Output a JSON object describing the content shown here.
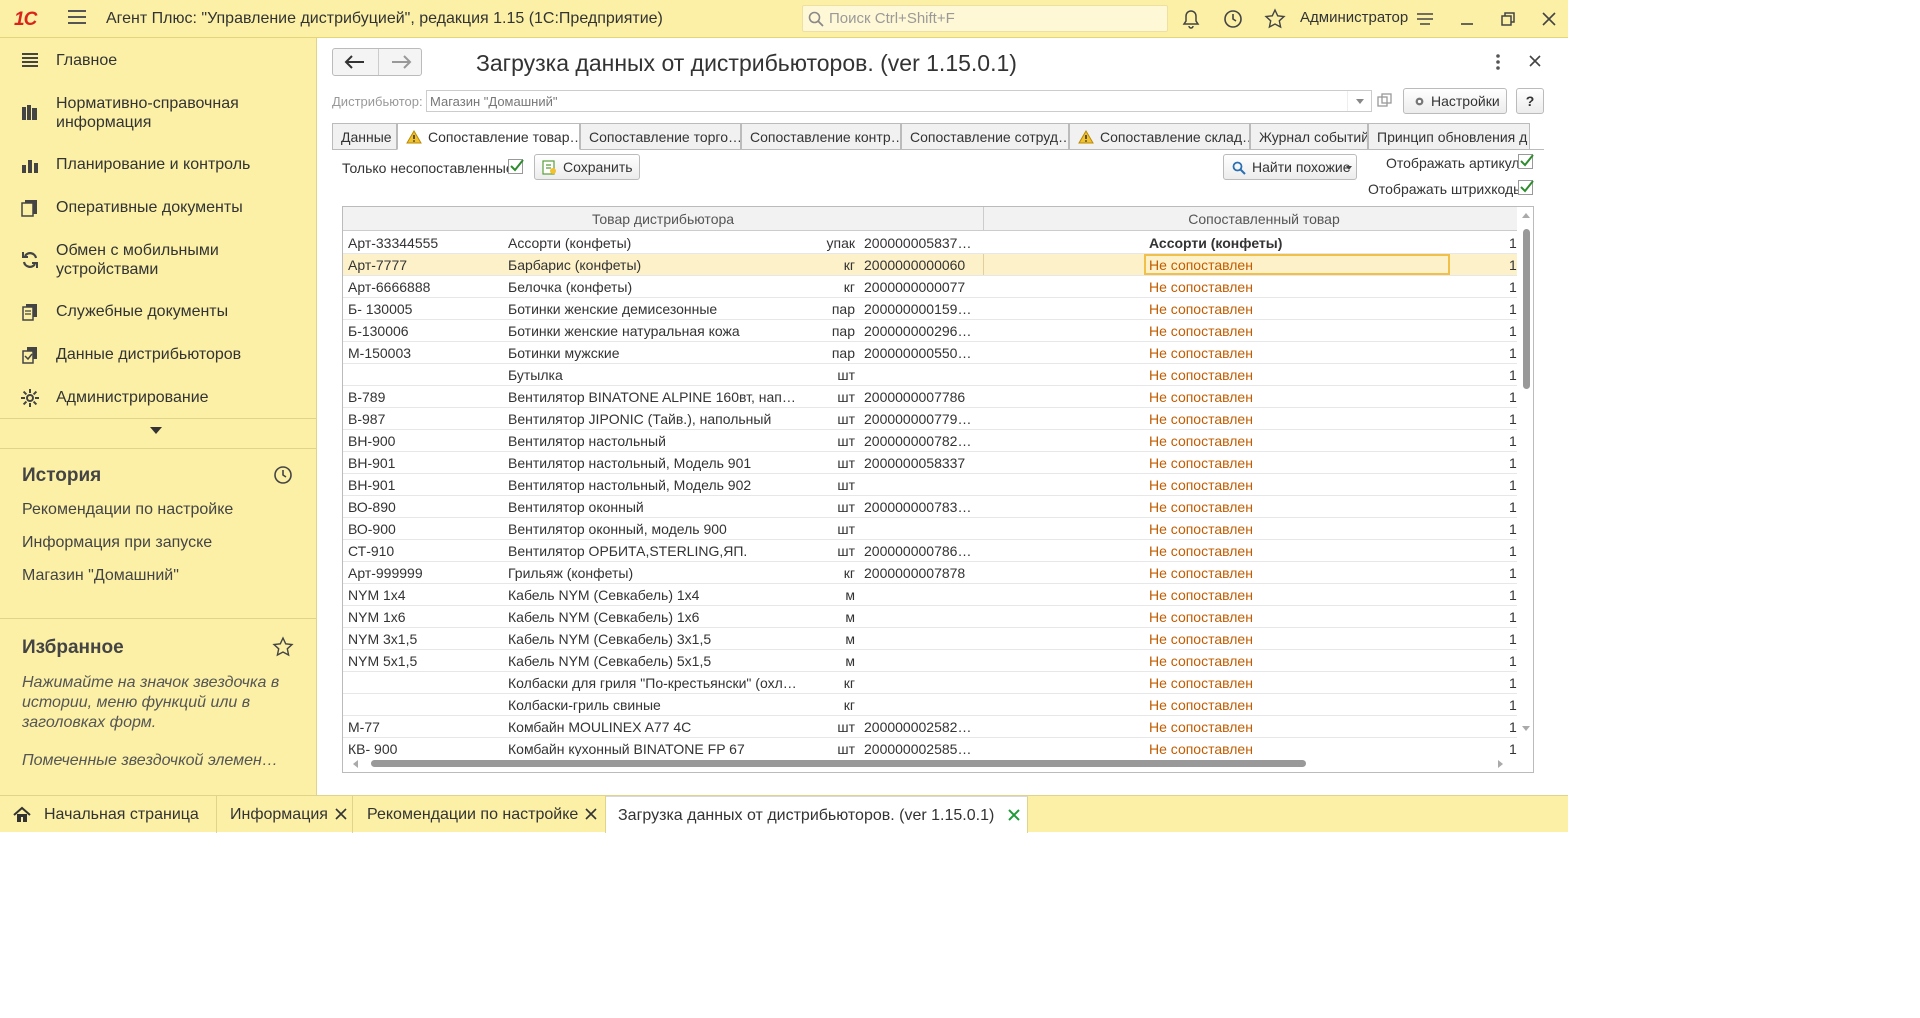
{
  "app": {
    "logo": "1С",
    "title": "Агент Плюс: \"Управление дистрибуцией\", редакция 1.15  (1С:Предприятие)",
    "search_placeholder": "Поиск Ctrl+Shift+F",
    "user": "Администратор"
  },
  "sidebar": {
    "items": [
      {
        "label": "Главное",
        "icon": "list-icon"
      },
      {
        "label": "Нормативно-справочная информация",
        "icon": "books-icon"
      },
      {
        "label": "Планирование и контроль",
        "icon": "bar-chart-icon"
      },
      {
        "label": "Оперативные документы",
        "icon": "documents-icon"
      },
      {
        "label": "Обмен с мобильными устройствами",
        "icon": "sync-icon"
      },
      {
        "label": "Служебные документы",
        "icon": "service-docs-icon"
      },
      {
        "label": "Данные дистрибьюторов",
        "icon": "distributor-data-icon"
      },
      {
        "label": "Администрирование",
        "icon": "gear-icon"
      }
    ],
    "history": {
      "title": "История",
      "links": [
        "Рекомендации по настройке",
        "Информация при запуске",
        "Магазин \"Домашний\""
      ]
    },
    "favorites": {
      "title": "Избранное",
      "hint": "Нажимайте на значок звездочка в истории, меню функций или в заголовках форм.",
      "hint2": "Помеченные звездочкой элемен…"
    }
  },
  "form": {
    "title": "Загрузка данных от дистрибьюторов. (ver 1.15.0.1)",
    "distributor_label": "Дистрибьютор:",
    "distributor_value": "Магазин \"Домашний\"",
    "settings_button": "Настройки",
    "help_button": "?",
    "tabs": [
      {
        "label": "Данные",
        "warn": false
      },
      {
        "label": "Сопоставление товар…",
        "warn": true
      },
      {
        "label": "Сопоставление торго…",
        "warn": false
      },
      {
        "label": "Сопоставление контр…",
        "warn": false
      },
      {
        "label": "Сопоставление сотруд…",
        "warn": false
      },
      {
        "label": "Сопоставление склад…",
        "warn": true
      },
      {
        "label": "Журнал событий",
        "warn": false
      },
      {
        "label": "Принцип обновления д…",
        "warn": false
      }
    ],
    "only_unmatched_label": "Только несопоставленные:",
    "only_unmatched_checked": true,
    "save_button": "Сохранить",
    "find_similar_button": "Найти похожие",
    "show_article_label": "Отображать артикул:",
    "show_article_checked": true,
    "show_barcodes_label": "Отображать штрихкоды:",
    "show_barcodes_checked": true
  },
  "table": {
    "headers": [
      "Товар дистрибьютора",
      "Сопоставленный товар"
    ],
    "selected_row": 1,
    "rows": [
      {
        "art": "Арт-33344555",
        "name": "Ассорти (конфеты)",
        "unit": "упак",
        "barcode": "2000000058375;…",
        "status": "Ассорти (конфеты)",
        "matched": true,
        "q": "1"
      },
      {
        "art": "Арт-7777",
        "name": "Барбарис (конфеты)",
        "unit": "кг",
        "barcode": "2000000000060",
        "status": "Не сопоставлен",
        "matched": false,
        "q": "1"
      },
      {
        "art": "Арт-6666888",
        "name": "Белочка (конфеты)",
        "unit": "кг",
        "barcode": "2000000000077",
        "status": "Не сопоставлен",
        "matched": false,
        "q": "1"
      },
      {
        "art": "Б- 130005",
        "name": "Ботинки женские демисезонные",
        "unit": "пар",
        "barcode": "2000000001593;…",
        "status": "Не сопоставлен",
        "matched": false,
        "q": "1"
      },
      {
        "art": "Б-130006",
        "name": "Ботинки женские натуральная кожа",
        "unit": "пар",
        "barcode": "2000000002965;…",
        "status": "Не сопоставлен",
        "matched": false,
        "q": "1"
      },
      {
        "art": "М-150003",
        "name": "Ботинки мужские",
        "unit": "пар",
        "barcode": "2000000005508;…",
        "status": "Не сопоставлен",
        "matched": false,
        "q": "1"
      },
      {
        "art": "",
        "name": "Бутылка",
        "unit": "шт",
        "barcode": "",
        "status": "Не сопоставлен",
        "matched": false,
        "q": "1"
      },
      {
        "art": "В-789",
        "name": "Вентилятор BINATONE ALPINE 160вт, напольн…",
        "unit": "шт",
        "barcode": "2000000007786",
        "status": "Не сопоставлен",
        "matched": false,
        "q": "1"
      },
      {
        "art": "В-987",
        "name": "Вентилятор JIPONIC (Тайв.), напольный",
        "unit": "шт",
        "barcode": "2000000007793;…",
        "status": "Не сопоставлен",
        "matched": false,
        "q": "1"
      },
      {
        "art": "ВН-900",
        "name": "Вентилятор настольный",
        "unit": "шт",
        "barcode": "2000000007823;…",
        "status": "Не сопоставлен",
        "matched": false,
        "q": "1"
      },
      {
        "art": "ВН-901",
        "name": "Вентилятор настольный, Модель 901",
        "unit": "шт",
        "barcode": "2000000058337",
        "status": "Не сопоставлен",
        "matched": false,
        "q": "1"
      },
      {
        "art": "ВН-901",
        "name": "Вентилятор настольный, Модель 902",
        "unit": "шт",
        "barcode": "",
        "status": "Не сопоставлен",
        "matched": false,
        "q": "1"
      },
      {
        "art": "ВО-890",
        "name": "Вентилятор оконный",
        "unit": "шт",
        "barcode": "2000000007830;…",
        "status": "Не сопоставлен",
        "matched": false,
        "q": "1"
      },
      {
        "art": "ВО-900",
        "name": "Вентилятор оконный, модель 900",
        "unit": "шт",
        "barcode": "",
        "status": "Не сопоставлен",
        "matched": false,
        "q": "1"
      },
      {
        "art": "СТ-910",
        "name": "Вентилятор ОРБИТА,STERLING,ЯП.",
        "unit": "шт",
        "barcode": "2000000007861;…",
        "status": "Не сопоставлен",
        "matched": false,
        "q": "1"
      },
      {
        "art": "Арт-999999",
        "name": "Грильяж (конфеты)",
        "unit": "кг",
        "barcode": "2000000007878",
        "status": "Не сопоставлен",
        "matched": false,
        "q": "1"
      },
      {
        "art": "NYM 1x4",
        "name": "Кабель NYM (Севкабель) 1х4",
        "unit": "м",
        "barcode": "",
        "status": "Не сопоставлен",
        "matched": false,
        "q": "1"
      },
      {
        "art": "NYM 1x6",
        "name": "Кабель NYM (Севкабель) 1х6",
        "unit": "м",
        "barcode": "",
        "status": "Не сопоставлен",
        "matched": false,
        "q": "1"
      },
      {
        "art": "NYM 3x1,5",
        "name": "Кабель NYM (Севкабель) 3х1,5",
        "unit": "м",
        "barcode": "",
        "status": "Не сопоставлен",
        "matched": false,
        "q": "1"
      },
      {
        "art": " NYM 5x1,5",
        "name": "Кабель NYM (Севкабель) 5х1,5",
        "unit": "м",
        "barcode": "",
        "status": "Не сопоставлен",
        "matched": false,
        "q": "1"
      },
      {
        "art": "",
        "name": "Колбаски для гриля \"По-крестьянски\" (охлажде…",
        "unit": "кг",
        "barcode": "",
        "status": "Не сопоставлен",
        "matched": false,
        "q": "1"
      },
      {
        "art": "",
        "name": "Колбаски-гриль свиные",
        "unit": "кг",
        "barcode": "",
        "status": "Не сопоставлен",
        "matched": false,
        "q": "1"
      },
      {
        "art": "М-77",
        "name": "Комбайн MOULINEX  A77 4C",
        "unit": "шт",
        "barcode": "2000000025827;…",
        "status": "Не сопоставлен",
        "matched": false,
        "q": "1"
      },
      {
        "art": "КВ- 900",
        "name": "Комбайн кухонный BINATONE FP 67",
        "unit": "шт",
        "barcode": "2000000025858;…",
        "status": "Не сопоставлен",
        "matched": false,
        "q": "1"
      }
    ]
  },
  "bottom_tabs": [
    {
      "label": "Начальная страница",
      "icon": "home-icon",
      "closable": false,
      "active": false
    },
    {
      "label": "Информация",
      "closable": true,
      "active": false
    },
    {
      "label": "Рекомендации по настройке",
      "closable": true,
      "active": false
    },
    {
      "label": "Загрузка данных от дистрибьюторов. (ver 1.15.0.1)",
      "closable": true,
      "active": true
    }
  ],
  "colors": {
    "panel_yellow": "#fbf0a6",
    "unmatched_text": "#c15c00",
    "selected_row": "#fdf1c9",
    "checkbox_green": "#2e8b2e",
    "close_x_green": "#1f9b3a",
    "logo_red": "#d9241c"
  }
}
